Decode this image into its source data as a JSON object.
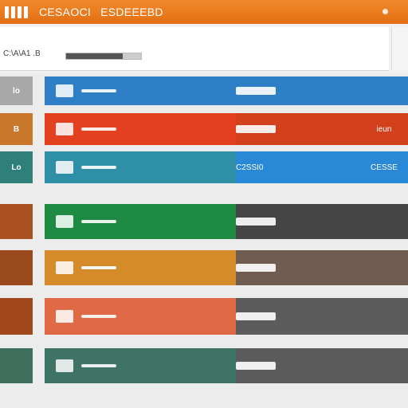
{
  "titlebar": {
    "title": "CESAOCI",
    "subtitle": "ESDEEEBD"
  },
  "toolbar": {
    "label": "C:\\A\\A1 .B",
    "progress_percent": 75
  },
  "rows": [
    {
      "thumb_text": "lo",
      "thumb_color": "#a8a8a8",
      "left_color": "#2f7fc6",
      "right_color": "#2f7fc6",
      "mid_label": "",
      "right_label": ""
    },
    {
      "thumb_text": "B",
      "thumb_color": "#c9772a",
      "left_color": "#e2401f",
      "right_color": "#d2401c",
      "mid_label": "",
      "right_label": "ieun"
    },
    {
      "thumb_text": "Lo",
      "thumb_color": "#2f7f7a",
      "left_color": "#2e8fa6",
      "right_color": "#2a89d6",
      "mid_label": "C2SSI0",
      "right_label": "CESSE"
    },
    {
      "thumb_text": "",
      "thumb_color": "#a8501f",
      "left_color": "#1e8a44",
      "right_color": "#454545",
      "mid_label": "",
      "right_label": ""
    },
    {
      "thumb_text": "",
      "thumb_color": "#9b4a1d",
      "left_color": "#d68b2a",
      "right_color": "#6f5b50",
      "mid_label": "",
      "right_label": ""
    },
    {
      "thumb_text": "",
      "thumb_color": "#a0481c",
      "left_color": "#e06a45",
      "right_color": "#5c5c5c",
      "mid_label": "",
      "right_label": ""
    },
    {
      "thumb_text": "",
      "thumb_color": "#3e6e5c",
      "left_color": "#3f7366",
      "right_color": "#5b5b5b",
      "mid_label": "",
      "right_label": ""
    }
  ]
}
